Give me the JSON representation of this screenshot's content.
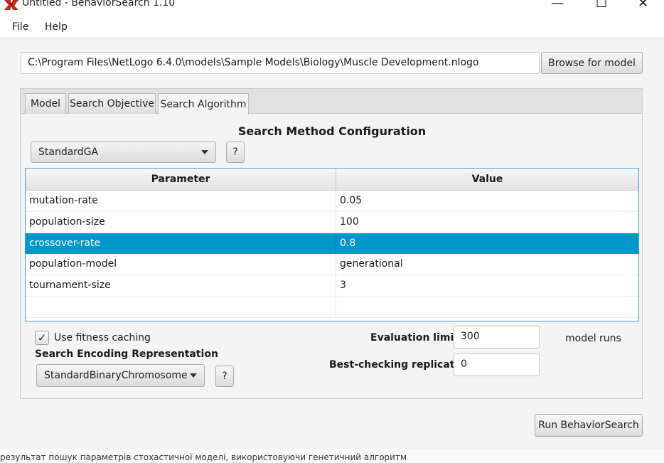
{
  "window": {
    "title": "Untitled - BehaviorSearch 1.10",
    "minimize_glyph": "—",
    "maximize_glyph": "☐",
    "close_glyph": "✕",
    "app_icon": "behaviorsearch-logo-icon"
  },
  "menu": {
    "items": [
      "File",
      "Help"
    ]
  },
  "model_path": {
    "value": "C:\\Program Files\\NetLogo 6.4.0\\models\\Sample Models\\Biology\\Muscle Development.nlogo",
    "browse_label": "Browse for model"
  },
  "tabs": [
    {
      "label": "Model",
      "active": false
    },
    {
      "label": "Search Objective",
      "active": false
    },
    {
      "label": "Search Algorithm",
      "active": true
    }
  ],
  "search_method": {
    "heading": "Search Method Configuration",
    "selected": "StandardGA",
    "help_label": "?"
  },
  "param_table": {
    "headers": [
      "Parameter",
      "Value"
    ],
    "rows": [
      {
        "parameter": "mutation-rate",
        "value": "0.05",
        "selected": false
      },
      {
        "parameter": "population-size",
        "value": "100",
        "selected": false
      },
      {
        "parameter": "crossover-rate",
        "value": "0.8",
        "selected": true
      },
      {
        "parameter": "population-model",
        "value": "generational",
        "selected": false
      },
      {
        "parameter": "tournament-size",
        "value": "3",
        "selected": false
      },
      {
        "parameter": "",
        "value": "",
        "selected": false
      }
    ]
  },
  "options": {
    "fitness_caching_label": "Use fitness caching",
    "fitness_caching_checked": true,
    "check_glyph": "✓",
    "encoding_label": "Search Encoding Representation",
    "encoding_selected": "StandardBinaryChromosome",
    "encoding_help": "?",
    "evaluation_limit_label": "Evaluation limit:",
    "evaluation_limit_value": "300",
    "evaluation_unit": "model runs",
    "best_checking_label": "Best-checking replicates:",
    "best_checking_value": "0"
  },
  "run_button_label": "Run BehaviorSearch",
  "background_text": "результат пошук параметрів стохастичної моделі, використовуючи генетичний алгоритм",
  "colors": {
    "selection": "#0096c9",
    "table_border": "#3aa0d8"
  }
}
